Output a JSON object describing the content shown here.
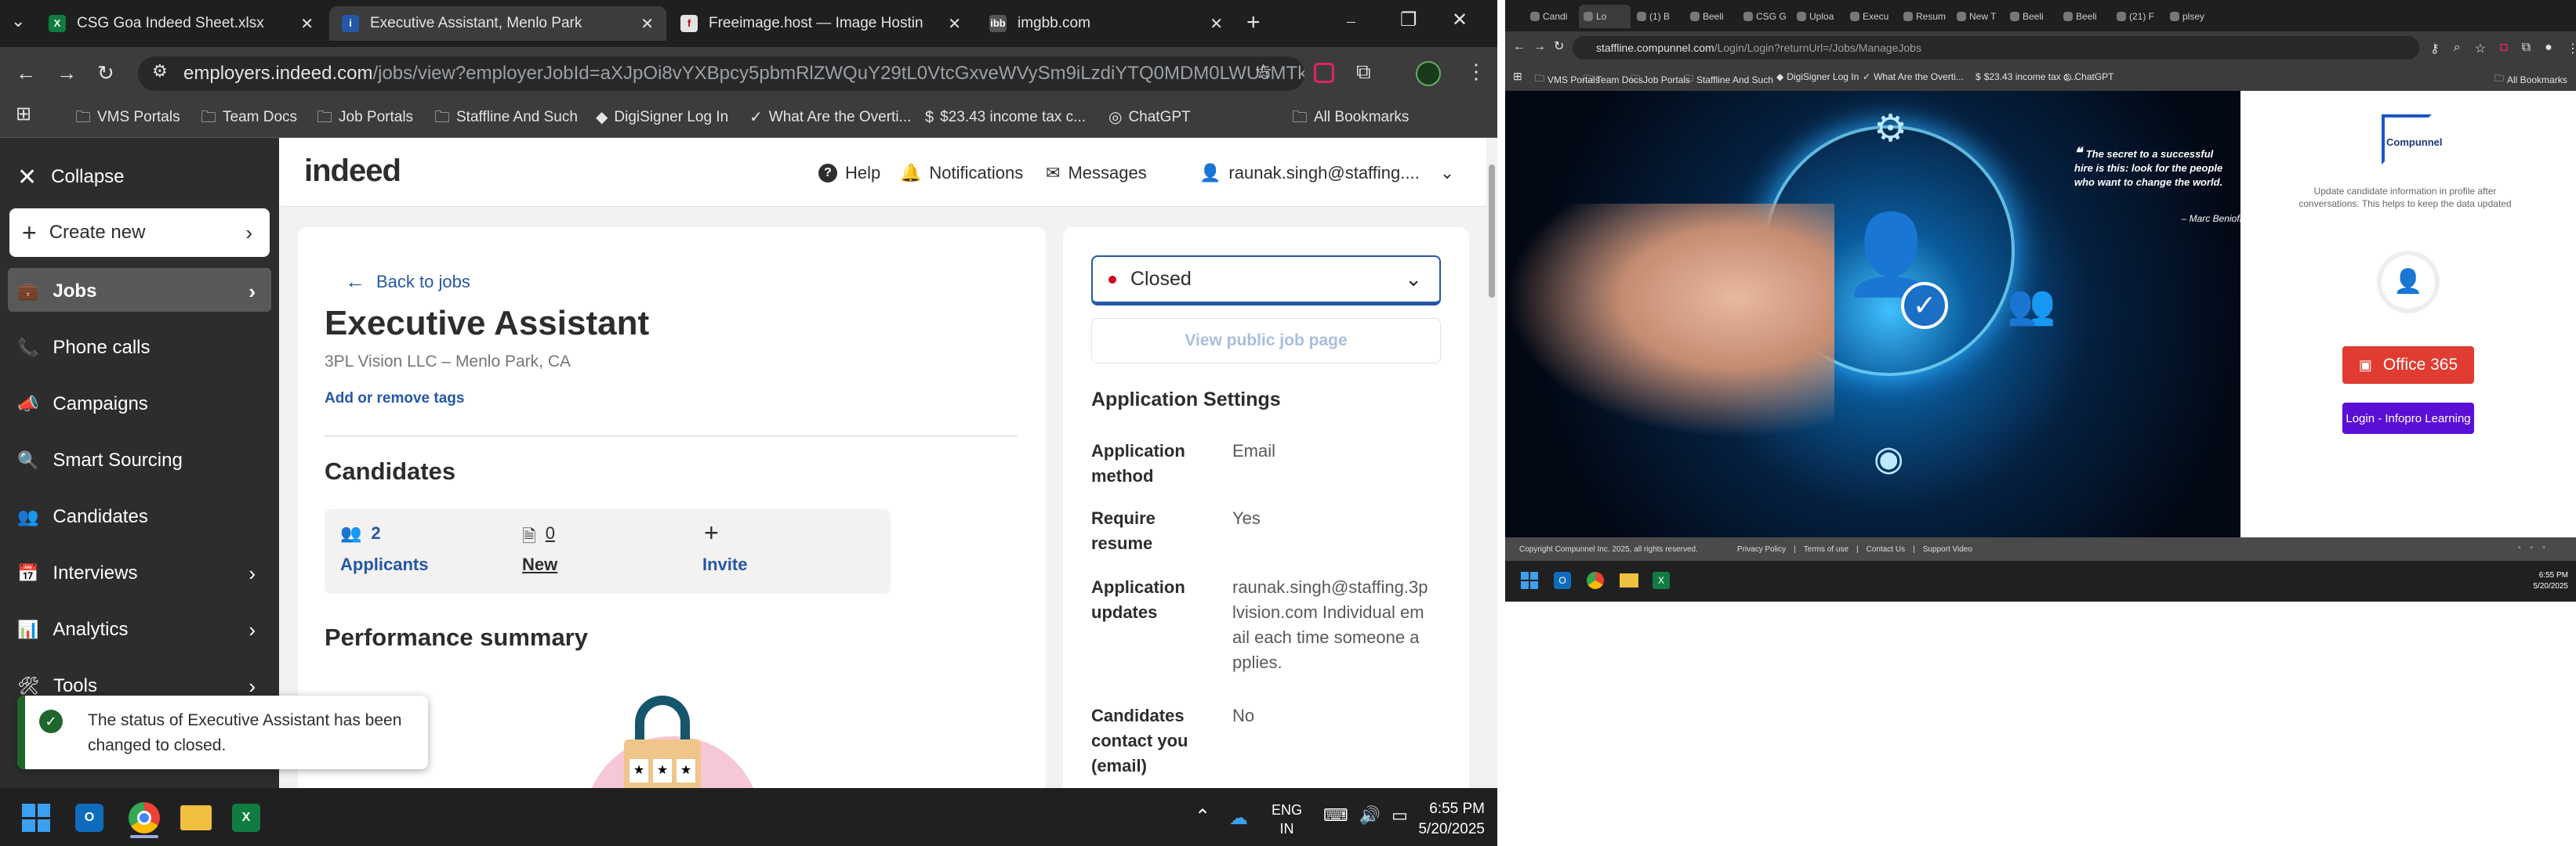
{
  "left": {
    "tabs": [
      {
        "title": "CSG Goa Indeed Sheet.xlsx",
        "icon": "excel-icon"
      },
      {
        "title": "Executive Assistant, Menlo Park",
        "icon": "indeed-icon"
      },
      {
        "title": "Freeimage.host — Image Hostin",
        "icon": "freeimage-icon"
      },
      {
        "title": "imgbb.com",
        "icon": "imgbb-icon"
      }
    ],
    "url_host": "employers.indeed.com",
    "url_path": "/jobs/view?employerJobId=aXJpOi8vYXBpcy5pbmRlZWQuY29tL0VtcGxveWVySm9iLzdiYTQ0MDM0LWU5MTktNGM1Mi1i...",
    "bookmarks": [
      "VMS Portals",
      "Team Docs",
      "Job Portals",
      "Staffline And Such",
      "DigiSigner Log In",
      "What Are the Overti...",
      "$23.43 income tax c...",
      "ChatGPT"
    ],
    "all_bookmarks": "All Bookmarks",
    "sidebar": {
      "collapse": "Collapse",
      "create_new": "Create new",
      "items": [
        "Jobs",
        "Phone calls",
        "Campaigns",
        "Smart Sourcing",
        "Candidates",
        "Interviews",
        "Analytics",
        "Tools"
      ]
    },
    "header": {
      "logo": "indeed",
      "help": "Help",
      "notifications": "Notifications",
      "messages": "Messages",
      "user": "raunak.singh@staffing...."
    },
    "job": {
      "back": "Back to jobs",
      "title": "Executive Assistant",
      "company": "3PL Vision LLC – Menlo Park, CA",
      "tags": "Add or remove tags",
      "candidates_heading": "Candidates",
      "applicants_count": "2",
      "applicants_label": "Applicants",
      "new_count": "0",
      "new_label": "New",
      "invite_label": "Invite",
      "perf_heading": "Performance summary"
    },
    "status": {
      "selected": "Closed",
      "view_public": "View public job page"
    },
    "settings": {
      "heading": "Application Settings",
      "rows": [
        {
          "label": "Application method",
          "value": "Email"
        },
        {
          "label": "Require resume",
          "value": "Yes"
        },
        {
          "label": "Application updates",
          "value": "raunak.singh@staffing.3plvision.com Individual email each time someone applies."
        },
        {
          "label": "Candidates contact you (email)",
          "value": "No"
        }
      ]
    },
    "toast": "The status of Executive Assistant has been changed to closed.",
    "taskbar": {
      "lang1": "ENG",
      "lang2": "IN",
      "time": "6:55 PM",
      "date": "5/20/2025"
    }
  },
  "right": {
    "tabs": [
      "Candi",
      "Lo",
      "(1) B",
      "Beeli",
      "CSG G",
      "Uploa",
      "Execu",
      "Resum",
      "New T",
      "Beeli",
      "Beeli",
      "(21) F",
      "plsey"
    ],
    "url_host": "staffline.compunnel.com",
    "url_path": "/Login/Login?returnUrl=/Jobs/ManageJobs",
    "bookmarks": [
      "VMS Portals",
      "Team Docs",
      "Job Portals",
      "Staffline And Such",
      "DigiSigner Log In",
      "What Are the Overti...",
      "$23.43 income tax c...",
      "ChatGPT"
    ],
    "all_bookmarks": "All Bookmarks",
    "quote": "The secret to a successful hire is this: look for the people who want to change the world.",
    "quote_author": "– Marc Benioff",
    "logo_text": "Compunnel",
    "update_text": "Update candidate information in profile after conversations. This helps to keep the data updated",
    "office_btn": "Office 365",
    "inforpro_btn": "Login - Infopro Learning",
    "footer": [
      "Copyright Compunnel Inc. 2025, all rights reserved.",
      "Privacy Policy",
      "Terms of use",
      "Contact Us",
      "Support Video"
    ],
    "time": "6:55 PM",
    "date": "5/20/2025"
  },
  "colors": {
    "indeed_blue": "#2557a7",
    "status_red": "#d0021b",
    "office_red": "#e03c31",
    "inforpro_purple": "#5b0fd6"
  }
}
